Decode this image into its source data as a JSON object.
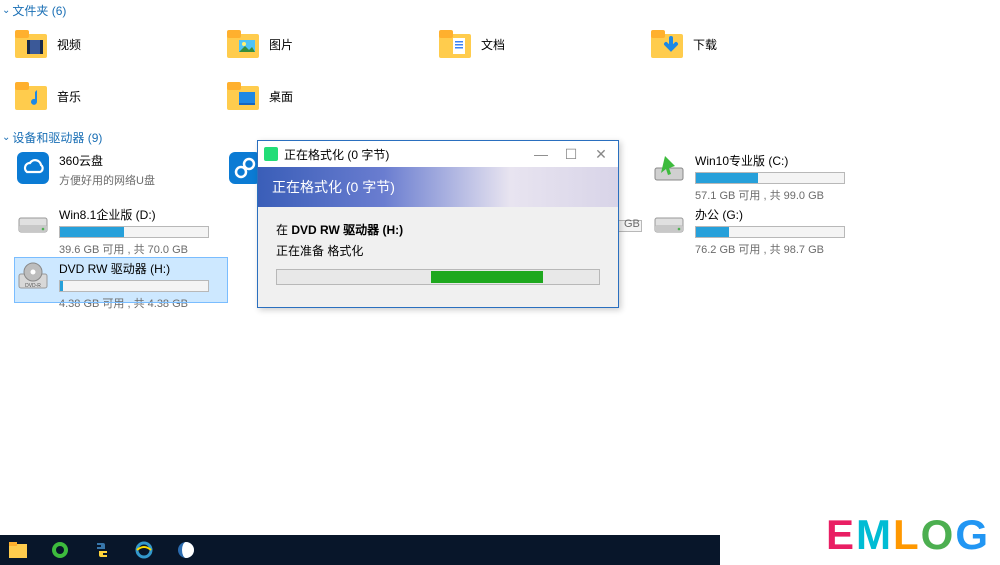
{
  "sections": {
    "folders_header": "文件夹 (6)",
    "drives_header": "设备和驱动器 (9)"
  },
  "folders": [
    {
      "id": "videos",
      "label": "视频",
      "color": "#b48c33",
      "glyph": "film"
    },
    {
      "id": "pictures",
      "label": "图片",
      "color": "#b48c33",
      "glyph": "photo"
    },
    {
      "id": "documents",
      "label": "文档",
      "color": "#b48c33",
      "glyph": "doc"
    },
    {
      "id": "downloads",
      "label": "下载",
      "color": "#b48c33",
      "glyph": "down"
    },
    {
      "id": "music",
      "label": "音乐",
      "color": "#b48c33",
      "glyph": "note"
    },
    {
      "id": "desktop",
      "label": "桌面",
      "color": "#b48c33",
      "glyph": "desk"
    }
  ],
  "drives": [
    {
      "id": "360",
      "title": "360云盘",
      "sub": "方便好用的网络U盘",
      "icon": "cloud",
      "bar": null,
      "selected": false
    },
    {
      "id": "obsc",
      "title": "",
      "sub": "",
      "icon": "link",
      "bar": null,
      "selected": false
    },
    {
      "id": "win10",
      "title": "Win10专业版 (C:)",
      "sub": "57.1 GB 可用 , 共 99.0 GB",
      "icon": "win",
      "bar": 42,
      "selected": false
    },
    {
      "id": "win81",
      "title": "Win8.1企业版 (D:)",
      "sub": "39.6 GB 可用 , 共 70.0 GB",
      "icon": "hdd",
      "bar": 43,
      "selected": false
    },
    {
      "id": "office",
      "title": "办公 (G:)",
      "sub": "76.2 GB 可用 , 共 98.7 GB",
      "icon": "hdd",
      "bar": 22,
      "selected": false
    },
    {
      "id": "dvd",
      "title": "DVD RW 驱动器 (H:)",
      "sub": "4.38 GB 可用 , 共 4.38 GB",
      "icon": "dvd",
      "bar": 2,
      "selected": true
    }
  ],
  "behind_size": "GB",
  "dialog": {
    "title": "正在格式化 (0 字节)",
    "band": "正在格式化 (0 字节)",
    "line_prefix": "在 ",
    "line_bold": "DVD RW 驱动器 (H:)",
    "line2": "正在准备 格式化",
    "min": "—",
    "max": "☐",
    "close": "✕"
  },
  "watermark": "EMLOG"
}
